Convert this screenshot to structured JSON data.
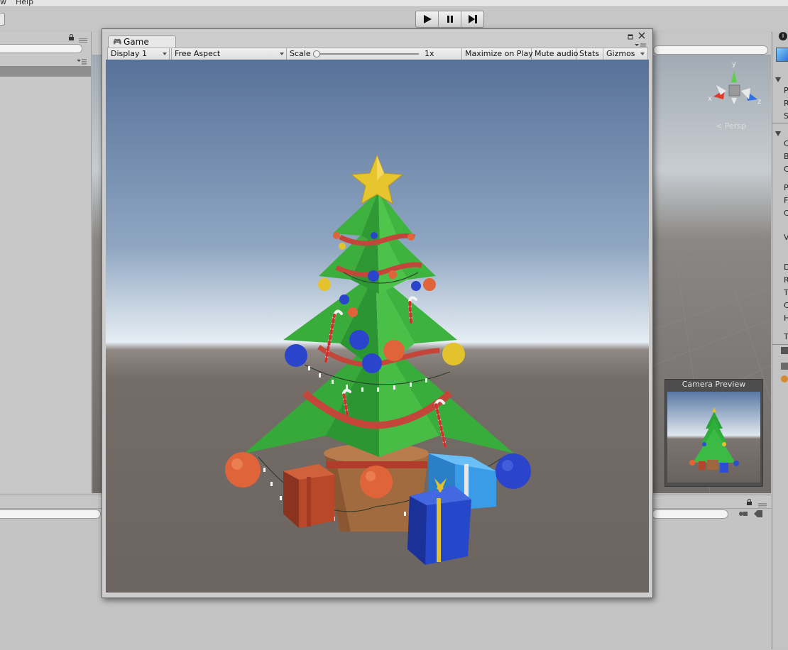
{
  "menu": {
    "left_item": "w",
    "help": "Help"
  },
  "toolbar": {
    "play_icon": "play-icon",
    "pause_icon": "pause-icon",
    "step_icon": "step-icon"
  },
  "scene": {
    "persp_label": "< Persp",
    "gizmo_y": "y",
    "gizmo_x": "x",
    "gizmo_z": "z"
  },
  "game": {
    "tab_label": "Game",
    "display": "Display 1",
    "aspect": "Free Aspect",
    "scale_label": "Scale",
    "scale_value": "1x",
    "scale_level": 0.0,
    "maximize": "Maximize on Play",
    "mute": "Mute audio",
    "stats": "Stats",
    "gizmos": "Gizmos"
  },
  "camera_preview": {
    "title": "Camera Preview"
  },
  "inspector": {
    "letters": [
      "P",
      "R",
      "S",
      "C",
      "B",
      "C",
      "P",
      "F",
      "C",
      "V",
      "D",
      "R",
      "T",
      "C",
      "H",
      "T"
    ]
  },
  "colors": {
    "accent_green": "#2fae3a",
    "sky_top": "#5d7496",
    "ground": "#6e6661"
  }
}
